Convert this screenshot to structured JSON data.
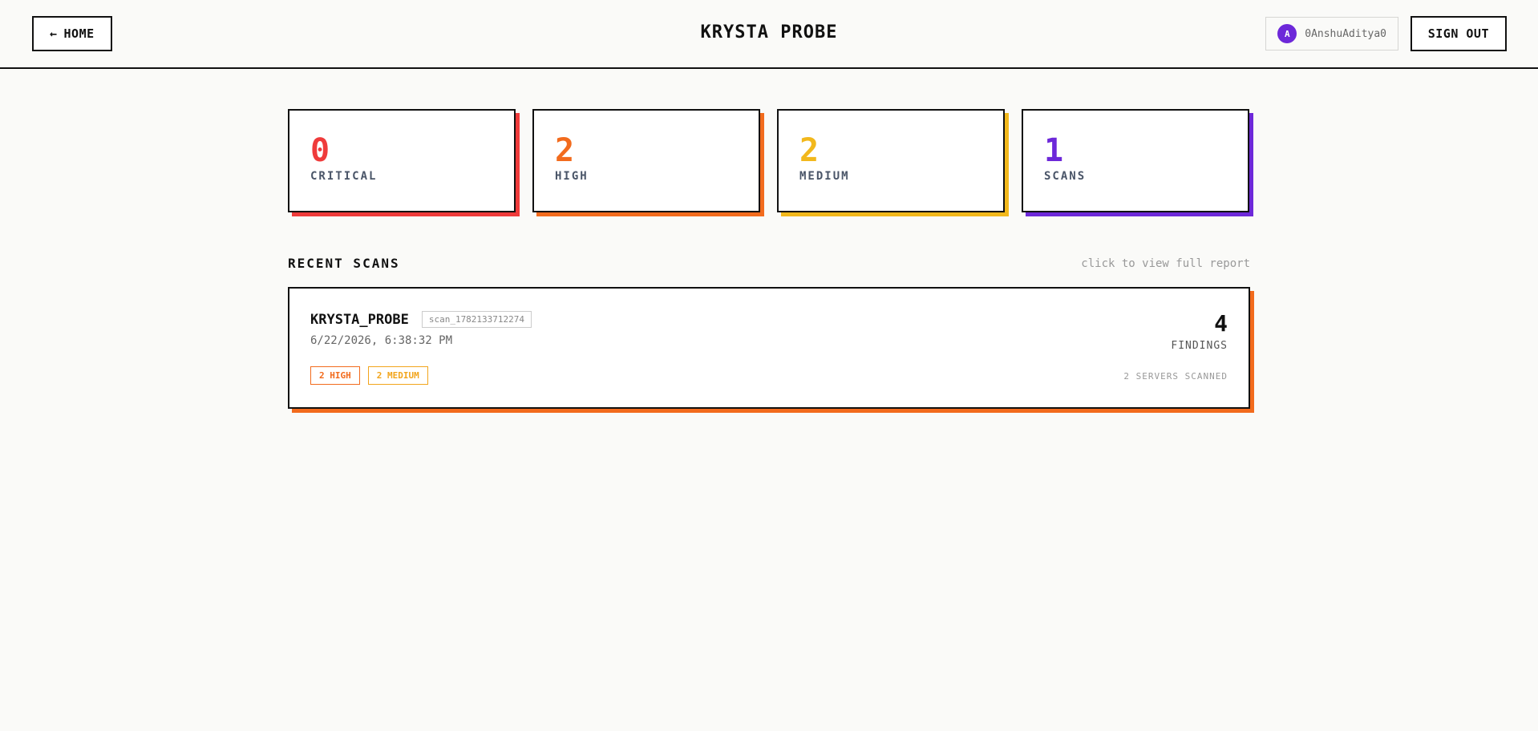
{
  "header": {
    "home_label": "HOME",
    "home_icon": "←",
    "title": "KRYSTA PROBE",
    "user": {
      "avatar_letter": "A",
      "username": "0AnshuAditya0"
    },
    "signout_label": "SIGN OUT"
  },
  "stats": [
    {
      "value": "0",
      "label": "CRITICAL",
      "color": "#ef3b3b"
    },
    {
      "value": "2",
      "label": "HIGH",
      "color": "#f26b1d"
    },
    {
      "value": "2",
      "label": "MEDIUM",
      "color": "#f2b81c"
    },
    {
      "value": "1",
      "label": "SCANS",
      "color": "#6d28d9"
    }
  ],
  "recent": {
    "title": "RECENT SCANS",
    "hint": "click to view full report",
    "scans": [
      {
        "name": "KRYSTA_PROBE",
        "id": "scan_1782133712274",
        "date": "6/22/2026, 6:38:32 PM",
        "tags": [
          "2 HIGH",
          "2 MEDIUM"
        ],
        "findings": "4",
        "findings_label": "FINDINGS",
        "servers": "2 SERVERS SCANNED"
      }
    ]
  }
}
